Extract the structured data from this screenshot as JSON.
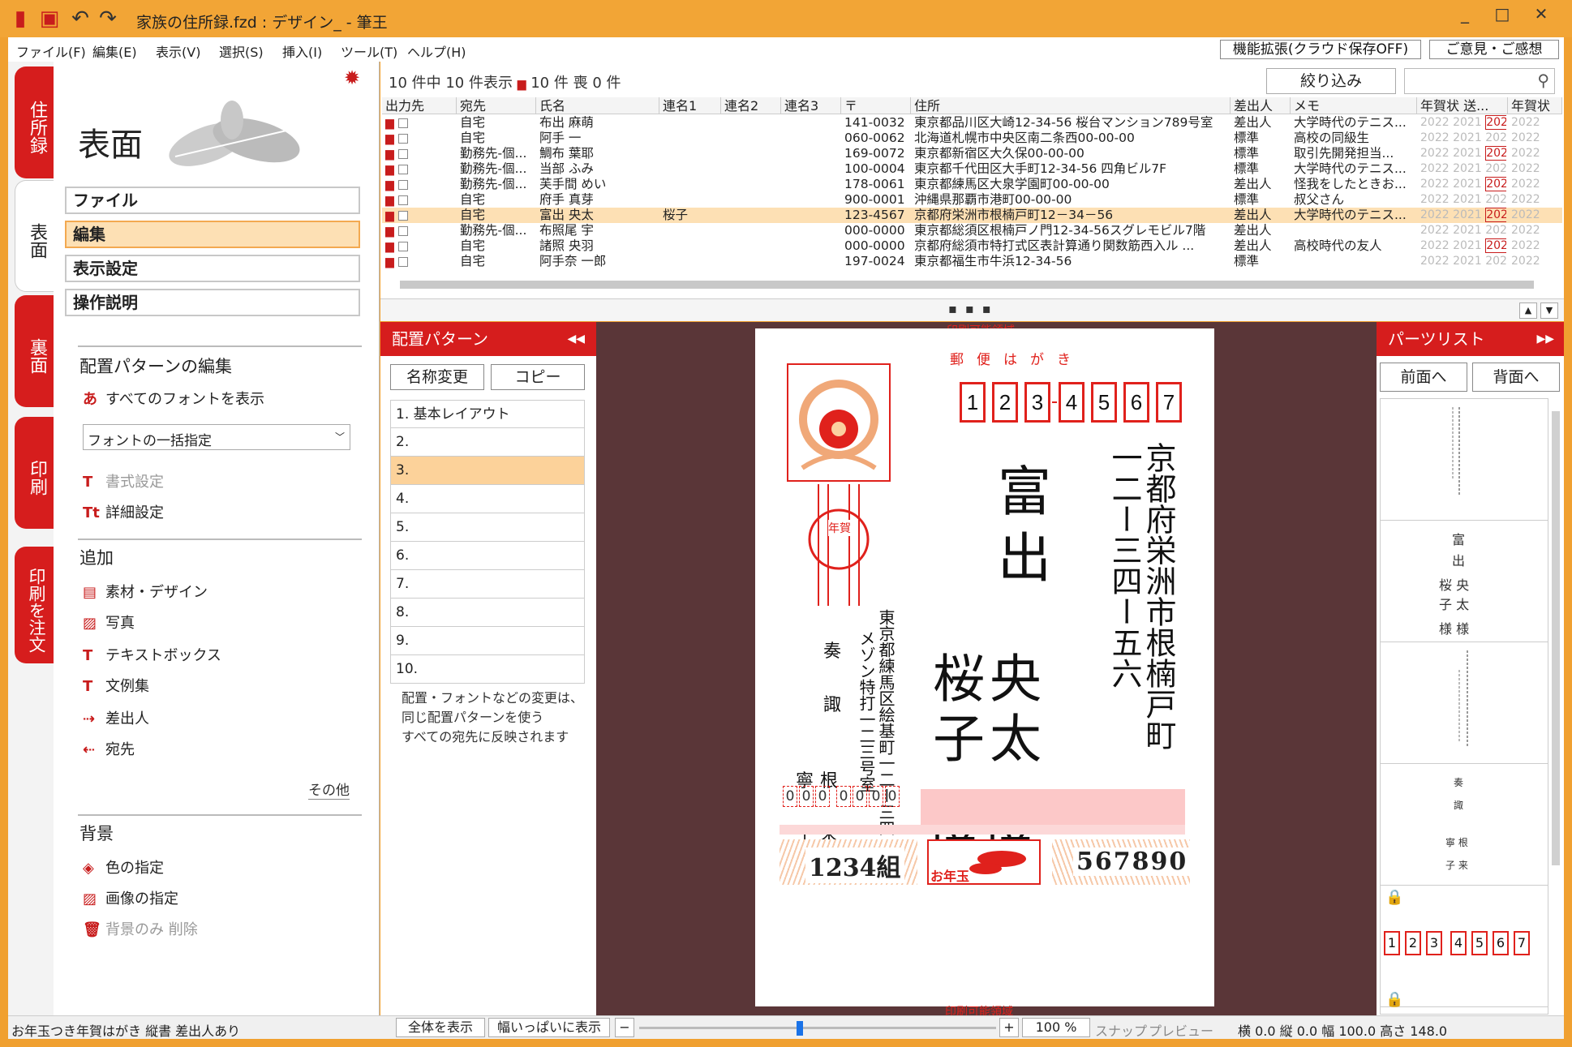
{
  "window": {
    "title": "家族の住所録.fzd : デザイン_ - 筆王",
    "min_icon": "_",
    "max_icon": "□",
    "close_icon": "✕"
  },
  "menu": {
    "items": [
      "ファイル(F)",
      "編集(E)",
      "表示(V)",
      "選択(S)",
      "挿入(I)",
      "ツール(T)",
      "ヘルプ(H)"
    ],
    "cloud_button": "機能拡張(クラウド保存OFF)",
    "feedback_button": "ご意見・ご感想"
  },
  "vtabs": [
    "住所録",
    "表面",
    "裏面",
    "印刷",
    "印刷を注文"
  ],
  "left_panel": {
    "title": "表面",
    "buttons": [
      "ファイル",
      "編集",
      "表示設定",
      "操作説明"
    ],
    "section_layout": "配置パターンの編集",
    "show_all_fonts": "すべてのフォントを表示",
    "font_dropdown": "フォントの一括指定",
    "format_setting": "書式設定",
    "detail_setting": "詳細設定",
    "section_add": "追加",
    "add_items": [
      "素材・デザイン",
      "写真",
      "テキストボックス",
      "文例集",
      "差出人",
      "宛先"
    ],
    "other_link": "その他",
    "section_bg": "背景",
    "bg_items": [
      "色の指定",
      "画像の指定",
      "背景のみ 削除"
    ]
  },
  "list": {
    "count_text": "10 件中 10 件表示",
    "print_count": "10 件",
    "mourning": "喪 0 件",
    "filter_button": "絞り込み",
    "columns": [
      "出力先",
      "宛先",
      "氏名",
      "連名1",
      "連名2",
      "連名3",
      "〒",
      "住所",
      "差出人",
      "メモ",
      "年賀状 送...",
      "年賀状"
    ],
    "rows": [
      {
        "dest": "自宅",
        "name": "布出 麻萌",
        "ren1": "",
        "zip": "141-0032",
        "addr": "東京都品川区大崎12-34-56 桜台マンション789号室",
        "sender": "差出人",
        "memo": "大学時代のテニス..."
      },
      {
        "dest": "自宅",
        "name": "阿手 一",
        "ren1": "",
        "zip": "060-0062",
        "addr": "北海道札幌市中央区南二条西00-00-00",
        "sender": "標準",
        "memo": "高校の同級生"
      },
      {
        "dest": "勤務先-個...",
        "name": "鯛布 葉耶",
        "ren1": "",
        "zip": "169-0072",
        "addr": "東京都新宿区大久保00-00-00",
        "sender": "標準",
        "memo": "取引先開発担当..."
      },
      {
        "dest": "勤務先-個...",
        "name": "当部 ふみ",
        "ren1": "",
        "zip": "100-0004",
        "addr": "東京都千代田区大手町12-34-56 四角ビル7F",
        "sender": "標準",
        "memo": "大学時代のテニス..."
      },
      {
        "dest": "勤務先-個...",
        "name": "芙手間 めい",
        "ren1": "",
        "zip": "178-0061",
        "addr": "東京都練馬区大泉学園町00-00-00",
        "sender": "差出人",
        "memo": "怪我をしたときお..."
      },
      {
        "dest": "自宅",
        "name": "府手 真芽",
        "ren1": "",
        "zip": "900-0001",
        "addr": "沖縄県那覇市港町00-00-00",
        "sender": "標準",
        "memo": "叔父さん"
      },
      {
        "dest": "自宅",
        "name": "富出 央太",
        "ren1": "桜子",
        "zip": "123-4567",
        "addr": "京都府栄洲市根楠戸町12－34－56",
        "sender": "差出人",
        "memo": "大学時代のテニス..."
      },
      {
        "dest": "勤務先-個...",
        "name": "布照尾 宇",
        "ren1": "",
        "zip": "000-0000",
        "addr": "東京都総須区根楠戸ノ門12-34-56スグレモビル7階",
        "sender": "差出人",
        "memo": ""
      },
      {
        "dest": "自宅",
        "name": "諸照 央羽",
        "ren1": "",
        "zip": "000-0000",
        "addr": "京都府総須市特打式区表計算通り関数筋西入ル ...",
        "sender": "差出人",
        "memo": "高校時代の友人"
      },
      {
        "dest": "自宅",
        "name": "阿手奈 一郎",
        "ren1": "",
        "zip": "197-0024",
        "addr": "東京都福生市牛浜12-34-56",
        "sender": "標準",
        "memo": ""
      }
    ],
    "years": [
      "2022",
      "2021",
      "202"
    ]
  },
  "pattern_panel": {
    "title": "配置パターン",
    "rename_button": "名称変更",
    "copy_button": "コピー",
    "items": [
      "1. 基本レイアウト",
      "2.",
      "3.",
      "4.",
      "5.",
      "6.",
      "7.",
      "8.",
      "9.",
      "10."
    ],
    "note_lines": [
      "配置・フォントなどの変更は、",
      "同じ配置パターンを使う",
      "すべての宛先に反映されます"
    ]
  },
  "card": {
    "print_area_label": "印刷可能領域",
    "postcard_label": "郵便はがき",
    "zip_digits": [
      "1",
      "2",
      "3",
      "4",
      "5",
      "6",
      "7"
    ],
    "address": "京都府栄洲市根楠戸町一二ー三四ー五六",
    "family_name": "富出",
    "given1": "央太",
    "given2": "桜子",
    "honorific": "様様",
    "sender_address": "東京都練馬区絵基町一二ー三四",
    "sender_building": "メゾン特打一二三号室",
    "sender_names": [
      "奏",
      "諏",
      "寧根",
      "子来"
    ],
    "sender_zip": [
      "0",
      "0",
      "0",
      "0",
      "0",
      "0",
      "0"
    ],
    "lottery_group": "1234組",
    "lottery_label": "お年玉",
    "lottery_number": "567890",
    "stamp_text": "年賀"
  },
  "parts_panel": {
    "title": "パーツリスト",
    "front_button": "前面へ",
    "back_button": "背面へ",
    "names_thumb": [
      "富",
      "出",
      "桜 央",
      "子 太",
      "様 様"
    ],
    "sender_thumb": [
      "奏",
      "諏",
      "寧 根",
      "子 来"
    ]
  },
  "status": {
    "text": "お年玉つき年賀はがき 縦書 差出人あり",
    "show_all": "全体を表示",
    "fit_width": "幅いっぱいに表示",
    "zoom": "100 %",
    "snap": "スナップ",
    "preview": "プレビュー",
    "coords": "横 0.0 縦 0.0 幅 100.0 高さ 148.0",
    "zoom_level": 0.45
  },
  "colors": {
    "accent": "#d61d1d",
    "title_bar": "#f2a536",
    "selected": "#fde0b4",
    "canvas_bg": "#5a3638"
  }
}
